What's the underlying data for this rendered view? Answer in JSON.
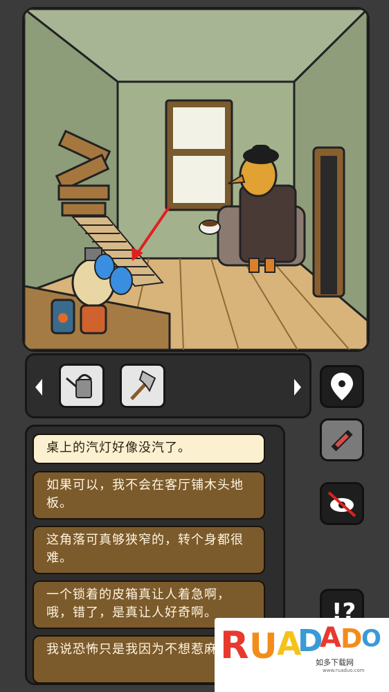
{
  "scene": {
    "name": "living-room-scene",
    "colors": {
      "wall": "#9aa887",
      "floor": "#d8b47a",
      "stairs": "#d7b987",
      "desk": "#a57b45",
      "chair": "#8a7a70",
      "coat": "#4a3a36",
      "beak": "#d9892b",
      "arrow": "#e02020"
    }
  },
  "inventory": {
    "items": [
      {
        "icon": "watering-can-icon"
      },
      {
        "icon": "axe-icon"
      }
    ]
  },
  "side_buttons": [
    {
      "icon": "location-pin-icon"
    },
    {
      "icon": "pencil-icon"
    },
    {
      "icon": "eye-crossed-icon"
    },
    {
      "icon": "hint-icon"
    }
  ],
  "dialogue": {
    "lines": [
      {
        "text": "桌上的汽灯好像没汽了。",
        "current": true
      },
      {
        "text": "如果可以，我不会在客厅铺木头地板。",
        "current": false
      },
      {
        "text": "这角落可真够狭窄的，转个身都很难。",
        "current": false
      },
      {
        "text": "一个锁着的皮箱真让人着急啊，哦，错了，是真让人好奇啊。",
        "current": false
      },
      {
        "text": "我说恐怖只是我因为不想惹麻烦。",
        "current": false
      }
    ]
  },
  "watermark": {
    "letters": [
      "R",
      "U",
      "A",
      "D",
      "A",
      "D",
      "O"
    ],
    "subtitle": "如多下载网",
    "url": "www.ruaduo.com"
  }
}
